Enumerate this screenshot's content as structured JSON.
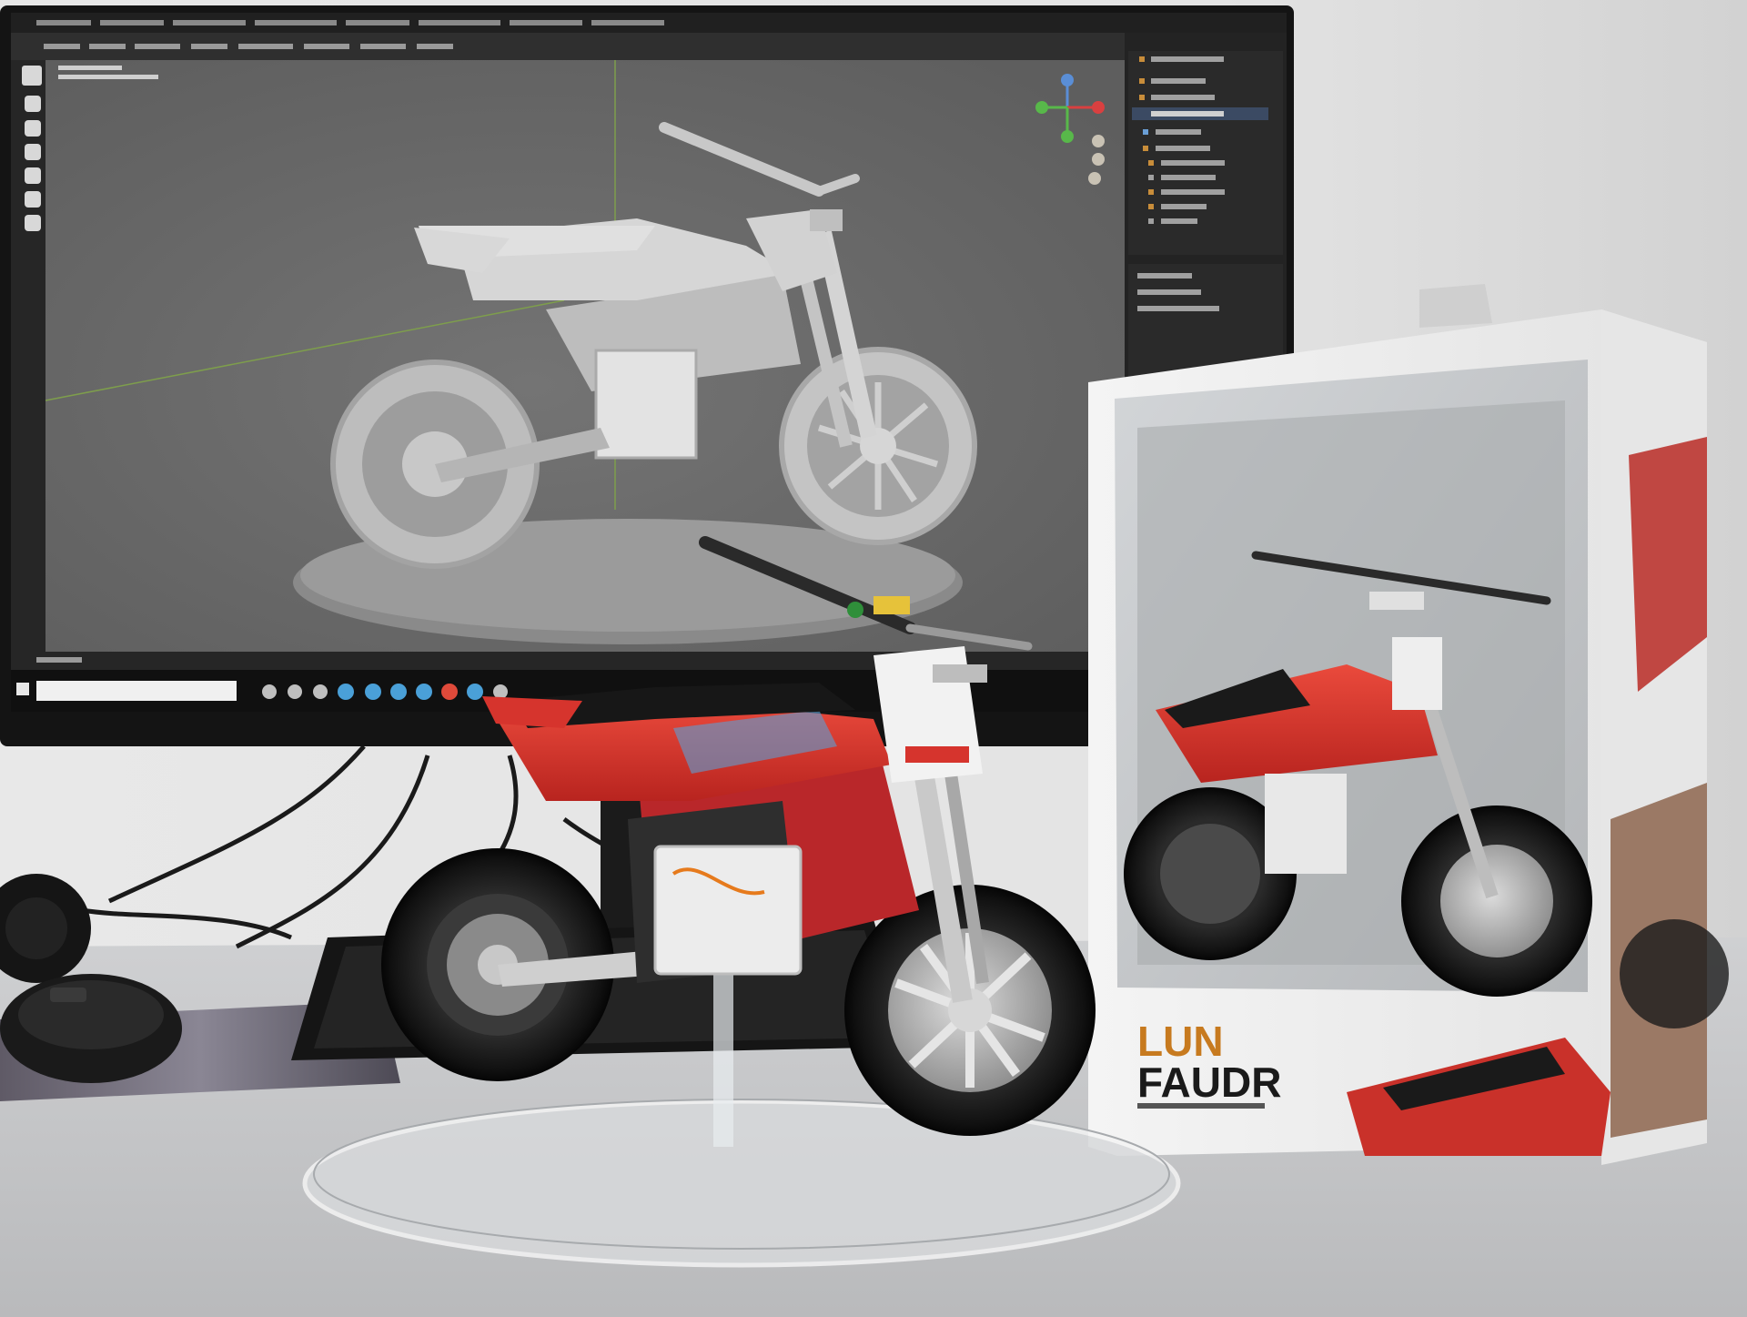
{
  "scene": {
    "colors": {
      "wall": "#e4e4e4",
      "desk": "#c9cacc",
      "bezel": "#141414",
      "viewport": "#6c6c6c",
      "model_grey": "#cfcfcf",
      "toy_red": "#d8312b",
      "box_white": "#f2f2f2"
    },
    "monitor": {
      "software": "3d-modeling-app",
      "panels": [
        "toolbar",
        "tool-icons",
        "viewport",
        "navigation-gizmo",
        "outliner",
        "properties",
        "timeline"
      ],
      "taskbar": {
        "app_icon_count": 10
      }
    },
    "figure": {
      "stand": "clear-acrylic-disc",
      "parts": [
        "handlebar",
        "number-plate",
        "front-fork",
        "fuel-tank",
        "seat",
        "frame",
        "battery-box",
        "front-wheel",
        "rear-wheel",
        "swingarm",
        "disc-brake"
      ]
    },
    "package": {
      "logo_line1": "LUN",
      "logo_line2": "FAUDR"
    },
    "desk_items": [
      "keyboard",
      "mouse",
      "headphones",
      "mouse-pad"
    ]
  }
}
